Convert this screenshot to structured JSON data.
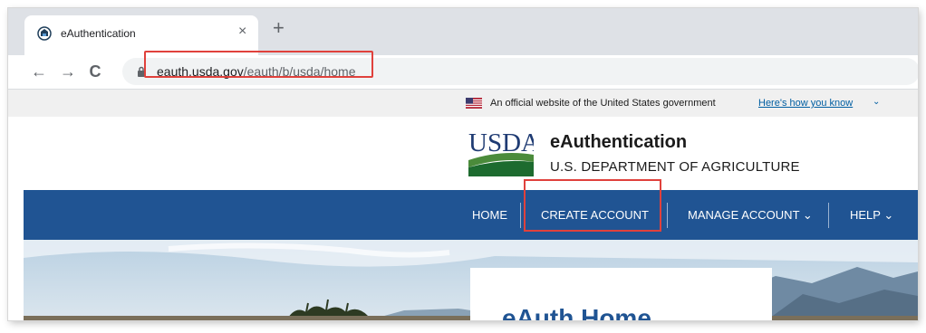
{
  "browser": {
    "tab_title": "eAuthentication",
    "tab_close": "×",
    "new_tab": "+",
    "back": "←",
    "forward": "→",
    "reload": "C",
    "url_host": "eauth.usda.gov",
    "url_path": "/eauth/b/usda/home"
  },
  "gov_banner": {
    "text": "An official website of the United States government",
    "link": "Here's how you know",
    "chevron": "⌄"
  },
  "header": {
    "logo_text": "USDA",
    "title": "eAuthentication",
    "subtitle": "U.S. DEPARTMENT OF AGRICULTURE"
  },
  "nav": {
    "items": [
      {
        "label": "HOME"
      },
      {
        "label": "CREATE ACCOUNT"
      },
      {
        "label": "MANAGE ACCOUNT",
        "caret": "⌄"
      },
      {
        "label": "HELP",
        "caret": "⌄"
      }
    ]
  },
  "hero": {
    "card_title": "eAuth Home"
  },
  "colors": {
    "nav_bg": "#205493",
    "highlight": "#e0413c",
    "link": "#005ea2"
  }
}
